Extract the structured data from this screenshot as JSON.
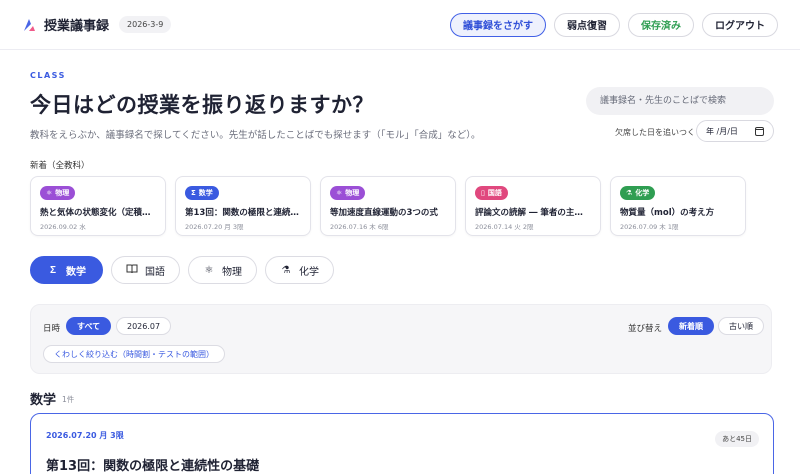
{
  "header": {
    "app_title": "授業議事録",
    "date": "2026-3-9",
    "buttons": {
      "search": "議事録をさがす",
      "review": "弱点復習",
      "saved": "保存済み",
      "logout": "ログアウト"
    }
  },
  "hero": {
    "tag": "CLASS",
    "title": "今日はどの授業を振り返りますか？",
    "subtitle": "教科をえらぶか、議事録名で探してください。先生が話したことばでも探せます（「モル」「合成」など）。",
    "search_placeholder": "議事録名・先生のことばで検索",
    "catchup_label": "欠席した日を追いつく",
    "date_placeholder": "年 /月/日"
  },
  "new_section": {
    "label": "新着（全教科）",
    "cards": [
      {
        "subject": "物理",
        "icon": "atom-icon",
        "color": "#9b4fd6",
        "title": "熱と気体の状態変化（定積…",
        "meta": "2026.09.02 水"
      },
      {
        "subject": "数学",
        "icon": "sigma-icon",
        "color": "#3a5ae0",
        "title": "第13回：関数の極限と連続…",
        "meta": "2026.07.20 月 3限"
      },
      {
        "subject": "物理",
        "icon": "atom-icon",
        "color": "#9b4fd6",
        "title": "等加速度直線運動の3つの式",
        "meta": "2026.07.16 木 6限"
      },
      {
        "subject": "国語",
        "icon": "book-icon",
        "color": "#e0487e",
        "title": "評論文の読解 ― 筆者の主…",
        "meta": "2026.07.14 火 2限"
      },
      {
        "subject": "化学",
        "icon": "flask-icon",
        "color": "#2f9e52",
        "title": "物質量（mol）の考え方",
        "meta": "2026.07.09 木 1限"
      }
    ]
  },
  "tabs": [
    {
      "label": "数学",
      "icon": "Σ"
    },
    {
      "label": "国語",
      "icon": "📖"
    },
    {
      "label": "物理",
      "icon": "⚛"
    },
    {
      "label": "化学",
      "icon": "⚗"
    }
  ],
  "filter": {
    "date_label": "日時",
    "all": "すべて",
    "month": "2026.07",
    "refine": "くわしく絞り込む（時間割・テストの範囲）",
    "sort_label": "並び替え",
    "newest": "新着順",
    "oldest": "古い順"
  },
  "section": {
    "title": "数学",
    "count": "1件"
  },
  "lesson": {
    "date": "2026.07.20 月 3限",
    "remaining": "あと45日",
    "title": "第13回：関数の極限と連続性の基礎"
  },
  "colors": {
    "accent": "#3a5ae0",
    "saved": "#2f9e52"
  }
}
